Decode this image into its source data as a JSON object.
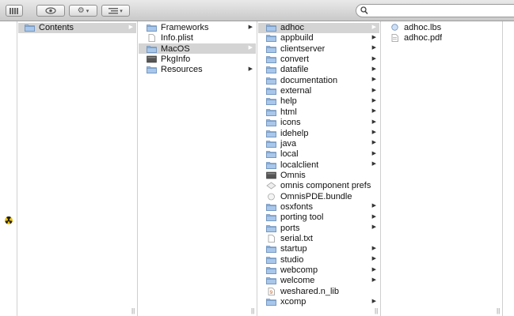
{
  "search": {
    "placeholder": ""
  },
  "columns": [
    {
      "items": [
        {
          "label": "Contents",
          "icon": "folder",
          "arrow": true,
          "state": "grey"
        }
      ]
    },
    {
      "items": [
        {
          "label": "Frameworks",
          "icon": "folder",
          "arrow": true
        },
        {
          "label": "Info.plist",
          "icon": "doc"
        },
        {
          "label": "MacOS",
          "icon": "folder",
          "arrow": true,
          "state": "grey"
        },
        {
          "label": "PkgInfo",
          "icon": "exec"
        },
        {
          "label": "Resources",
          "icon": "folder",
          "arrow": true
        }
      ]
    },
    {
      "items": [
        {
          "label": "adhoc",
          "icon": "folder",
          "arrow": true,
          "state": "grey"
        },
        {
          "label": "appbuild",
          "icon": "folder",
          "arrow": true
        },
        {
          "label": "clientserver",
          "icon": "folder",
          "arrow": true
        },
        {
          "label": "convert",
          "icon": "folder",
          "arrow": true
        },
        {
          "label": "datafile",
          "icon": "folder",
          "arrow": true
        },
        {
          "label": "documentation",
          "icon": "folder",
          "arrow": true
        },
        {
          "label": "external",
          "icon": "folder",
          "arrow": true
        },
        {
          "label": "help",
          "icon": "folder",
          "arrow": true
        },
        {
          "label": "html",
          "icon": "folder",
          "arrow": true
        },
        {
          "label": "icons",
          "icon": "folder",
          "arrow": true
        },
        {
          "label": "idehelp",
          "icon": "folder",
          "arrow": true
        },
        {
          "label": "java",
          "icon": "folder",
          "arrow": true
        },
        {
          "label": "local",
          "icon": "folder",
          "arrow": true
        },
        {
          "label": "localclient",
          "icon": "folder",
          "arrow": true
        },
        {
          "label": "Omnis",
          "icon": "exec"
        },
        {
          "label": "omnis component prefs",
          "icon": "prefs"
        },
        {
          "label": "OmnisPDE.bundle",
          "icon": "bundle"
        },
        {
          "label": "osxfonts",
          "icon": "folder",
          "arrow": true
        },
        {
          "label": "porting tool",
          "icon": "folder",
          "arrow": true
        },
        {
          "label": "ports",
          "icon": "folder",
          "arrow": true
        },
        {
          "label": "serial.txt",
          "icon": "doc"
        },
        {
          "label": "startup",
          "icon": "folder",
          "arrow": true
        },
        {
          "label": "studio",
          "icon": "folder",
          "arrow": true
        },
        {
          "label": "webcomp",
          "icon": "folder",
          "arrow": true
        },
        {
          "label": "welcome",
          "icon": "folder",
          "arrow": true
        },
        {
          "label": "weshared.n_lib",
          "icon": "lib"
        },
        {
          "label": "xcomp",
          "icon": "folder",
          "arrow": true
        }
      ]
    },
    {
      "items": [
        {
          "label": "adhoc.lbs",
          "icon": "lbs"
        },
        {
          "label": "adhoc.pdf",
          "icon": "pdf"
        }
      ]
    }
  ]
}
